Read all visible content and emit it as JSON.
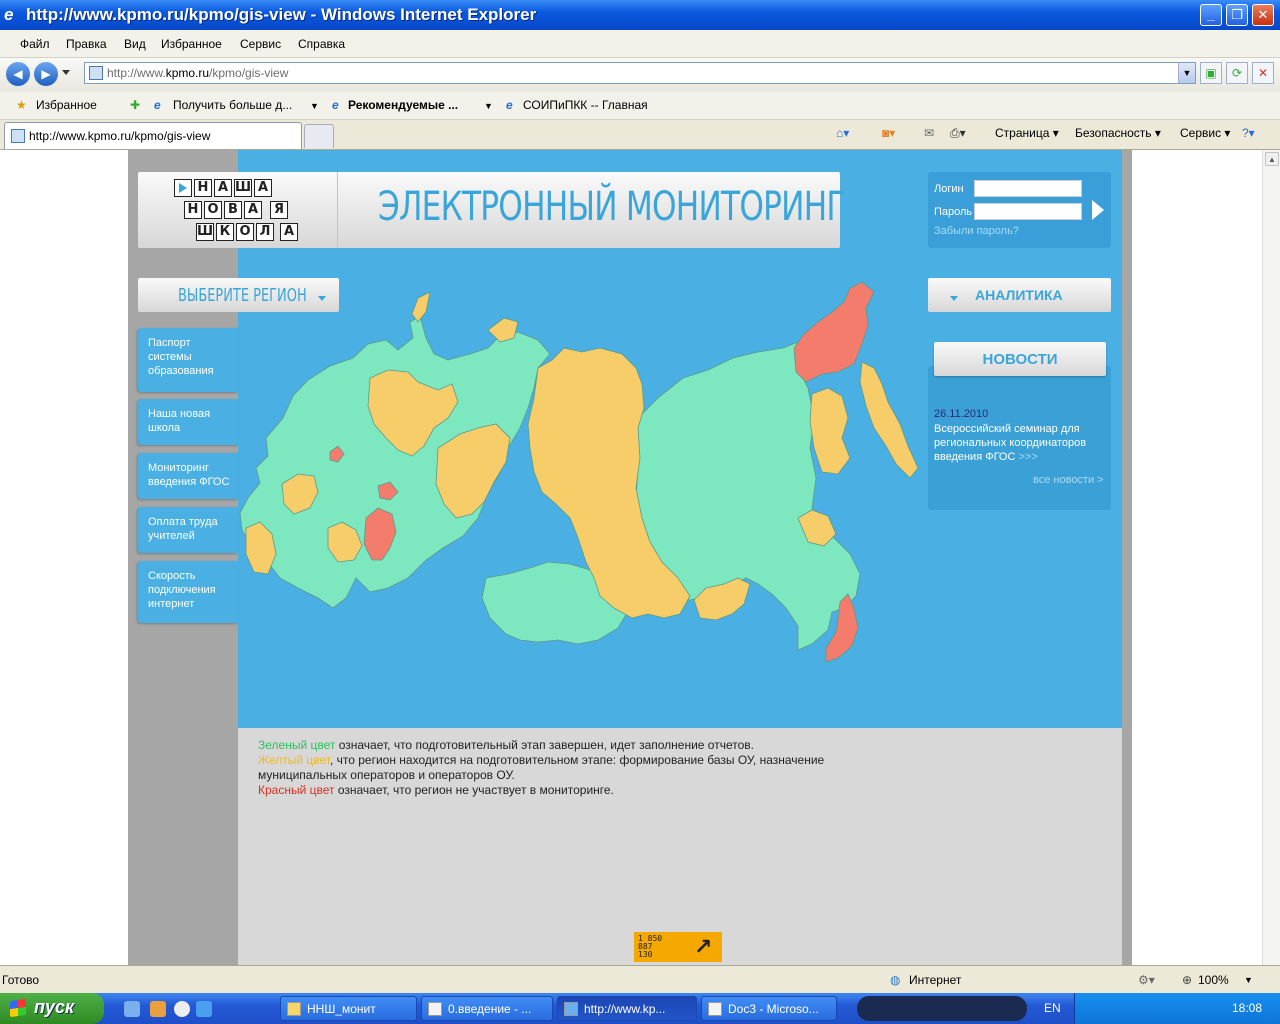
{
  "window": {
    "title": "http://www.kpmo.ru/kpmo/gis-view - Windows Internet Explorer"
  },
  "menu": [
    "Файл",
    "Правка",
    "Вид",
    "Избранное",
    "Сервис",
    "Справка"
  ],
  "address": {
    "prefix": "http://www.",
    "domain": "kpmo.ru",
    "path": "/kpmo/gis-view"
  },
  "favorites": {
    "fav_label": "Избранное",
    "links": [
      "Получить больше д...",
      "Рекомендуемые ...",
      "СОИПиПКК -- Главная"
    ]
  },
  "tab": {
    "label": "http://www.kpmo.ru/kpmo/gis-view"
  },
  "commands": {
    "page": "Страница",
    "security": "Безопасность",
    "tools": "Сервис"
  },
  "logo": {
    "row1": [
      "Н",
      "А",
      "Ш",
      "А"
    ],
    "row2": [
      "Н",
      "О",
      "В",
      "А",
      "Я"
    ],
    "row3": [
      "Ш",
      "К",
      "О",
      "Л",
      "А"
    ]
  },
  "site": {
    "main_title": "ЭЛЕКТРОННЫЙ МОНИТОРИНГ",
    "login_label": "Логин",
    "password_label": "Пароль",
    "forgot": "Забыли пароль?",
    "region_btn": "ВЫБЕРИТЕ РЕГИОН",
    "analytics_btn": "АНАЛИТИКА",
    "news_btn": "НОВОСТИ",
    "nav": [
      "Паспорт системы образования",
      "Наша новая школа",
      "Мониторинг введения ФГОС",
      "Оплата труда учителей",
      "Скорость подключения интернет"
    ],
    "news": {
      "date": "26.11.2010",
      "text": "Всероссийский семинар для региональных координаторов введения ФГОС",
      "more": ">>>",
      "all": "все новости >"
    },
    "legend": {
      "green_term": "Зеленый цвет",
      "green_text": " означает, что подготовительный этап завершен, идет заполнение отчетов.",
      "yellow_term": "Желтый цвет",
      "yellow_text": ", что регион находится на подготовительном этапе: формирование базы ОУ, назначение муниципальных операторов и операторов ОУ.",
      "red_term": "Красный цвет",
      "red_text": " означает, что регион не участвует в мониторинге."
    },
    "counter": [
      "1 850",
      "887",
      "130"
    ],
    "colors": {
      "green": "#7de8c0",
      "yellow": "#f7cd6a",
      "red": "#f37c6c",
      "blue": "#4ab0e4"
    }
  },
  "status": {
    "left": "Готово",
    "zone": "Интернет",
    "zoom": "100%"
  },
  "taskbar": {
    "start": "пуск",
    "tasks": [
      "ННШ_монит",
      "0.введение - ...",
      "http://www.kp...",
      "Doc3 - Microso..."
    ],
    "lang": "EN",
    "clock": "18:08"
  }
}
